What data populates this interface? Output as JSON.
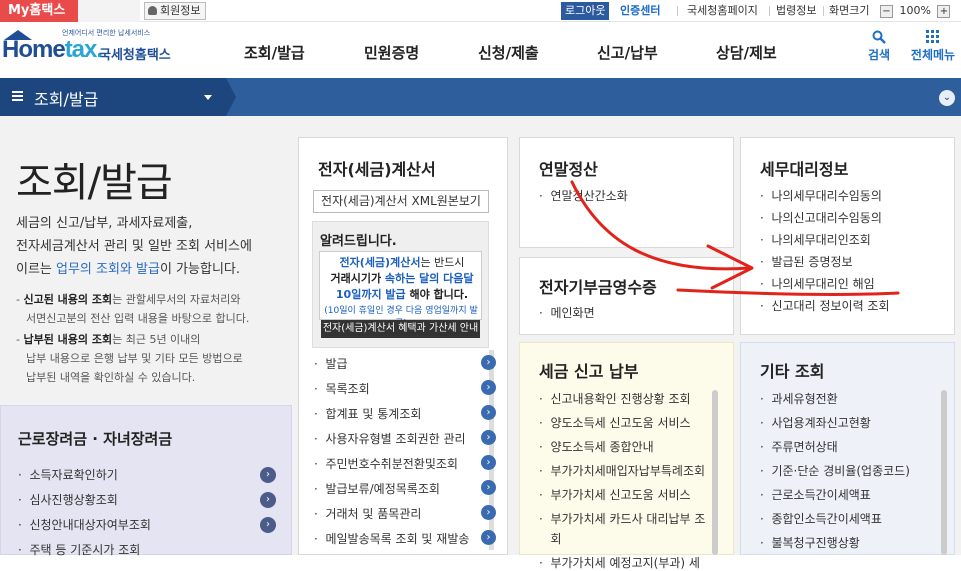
{
  "util": {
    "myhome": "My홈택스",
    "member": "회원정보",
    "logout": "로그아웃",
    "cert": "인증센터",
    "links": [
      "국세청홈페이지",
      "법령정보",
      "화면크기"
    ],
    "zoom_minus": "−",
    "zoom_value": "100%",
    "zoom_plus": "+"
  },
  "header": {
    "logo_tagline": "언제어디서 편리한 납세서비스",
    "logo_text_a": "Home",
    "logo_text_b": "tax.",
    "logo_kr": "국세청홈택스",
    "gnb": [
      "조회/발급",
      "민원증명",
      "신청/제출",
      "신고/납부",
      "상담/제보"
    ],
    "search_label": "검색",
    "allmenu_label": "전체메뉴"
  },
  "menubar": {
    "title": "조회/발급",
    "expand": "⌄"
  },
  "page": {
    "title": "조회/발급",
    "desc_1": "세금의 신고/납부, 과세자료제출,",
    "desc_2": "전자세금계산서 관리 및 일반 조회 서비스에",
    "desc_3a": "이르는 ",
    "desc_3b": "업무의 조회와 발급",
    "desc_3c": "이 가능합니다.",
    "note1_b": "신고된 내용의 조회",
    "note1_a": "- ",
    "note1_c": "는 관할세무서의 자료처리와",
    "note1_d": "서면신고분의 전산 입력 내용을 바탕으로 합니다.",
    "note2_a": "- ",
    "note2_b": "납부된 내용의 조회",
    "note2_c": "는 최근 5년 이내의",
    "note2_d": "납부 내용으로 은행 납부 및 기타 모든 방법으로",
    "note2_e": "납부된 내역을 확인하실 수 있습니다."
  },
  "left_panel": {
    "title": "근로장려금 · 자녀장려금",
    "items": [
      "소득자료확인하기",
      "심사진행상황조회",
      "신청안내대상자여부조회",
      "주택 등 기준시가 조회"
    ]
  },
  "einvoice": {
    "title": "전자(세금)계산서",
    "xml_button": "전자(세금)계산서 XML원본보기",
    "notice_title": "알려드립니다.",
    "notice_l1a": "전자(세금)계산서",
    "notice_l1b": "는 반드시",
    "notice_l2a": "거래시기가 ",
    "notice_l2b": "속하는 달의 다음달",
    "notice_l3a": "10일까지 발급",
    "notice_l3b": " 해야 합니다.",
    "notice_sub": "(10일이 휴일인 경우 다음 영업일까지 발급)",
    "notice_btn": "전자(세금)계산서 혜택과 가산세 안내",
    "items": [
      "발급",
      "목록조회",
      "합계표 및 통계조회",
      "사용자유형별 조회권한 관리",
      "주민번호수취분전환및조회",
      "발급보류/예정목록조회",
      "거래처 및 품목관리",
      "메일발송목록 조회 및 재발송"
    ]
  },
  "yearend": {
    "title": "연말정산",
    "items": [
      "연말정산간소화"
    ]
  },
  "donation": {
    "title": "전자기부금영수증",
    "items": [
      "메인화면"
    ]
  },
  "agent": {
    "title": "세무대리정보",
    "items": [
      "나의세무대리수임동의",
      "나의신고대리수임동의",
      "나의세무대리인조회",
      "발급된 증명정보",
      "나의세무대리인 해임",
      "신고대리 정보이력 조회"
    ]
  },
  "taxreport": {
    "title": "세금 신고 납부",
    "items": [
      "신고내용확인 진행상황 조회",
      "양도소득세 신고도움 서비스",
      "양도소득세 종합안내",
      "부가가치세매입자납부특례조회",
      "부가가치세 신고도움 서비스",
      "부가가치세 카드사 대리납부 조",
      "회",
      "부가가치세 예정고지(부과) 세"
    ]
  },
  "other": {
    "title": "기타 조회",
    "items": [
      "과세유형전환",
      "사업용계좌신고현황",
      "주류면허상태",
      "기준·단순 경비율(업종코드)",
      "근로소득간이세액표",
      "종합인소득간이세액표",
      "불복청구진행상황"
    ]
  },
  "bullet": "·",
  "arrow_glyph": "›",
  "colors": {
    "brand": "#1f4e96",
    "menubar": "#2e5e9c",
    "annotation": "#e2231a"
  }
}
